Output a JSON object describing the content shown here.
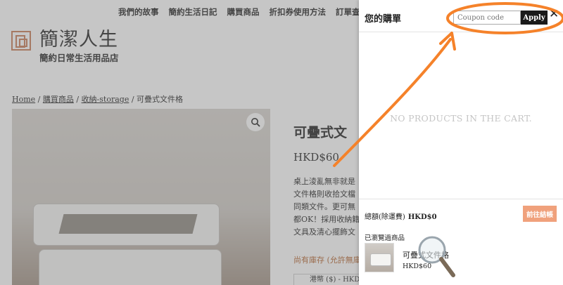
{
  "nav": {
    "items": [
      "我們的故事",
      "簡約生活日記",
      "購買商品",
      "折扣券使用方法",
      "訂單查"
    ]
  },
  "site": {
    "title": "簡潔人生",
    "tagline": "簡約日常生活用品店"
  },
  "breadcrumb": {
    "home": "Home",
    "sep": " / ",
    "shop": "購買商品",
    "category": "收納-storage",
    "current": "可疊式文件格"
  },
  "product": {
    "title": "可疊式文",
    "price": "HKD$60",
    "desc_lines": [
      "桌上淩亂無非就是",
      "文件格則收拾文檔",
      "同類文件。更可無",
      "都OK！採用收納籍",
      "文具及清心擺飾文"
    ],
    "stock": "尚有庫存 (允許無庫",
    "currency": "港幣 ($) - HKD"
  },
  "cart": {
    "title": "您的購單",
    "coupon_placeholder": "Coupon code",
    "apply_label": "Apply",
    "close_symbol": "✕",
    "empty_message": "NO PRODUCTS IN THE CART.",
    "subtotal_label": "總額(除運費)",
    "subtotal_value": "HKD$0",
    "checkout_label": "前往結帳",
    "recent_heading": "已瀏覽過商品",
    "recent_item_name": "可疊式文件格",
    "recent_item_price": "HKD$60"
  },
  "colors": {
    "annotation_orange": "#f5822a",
    "checkout_button": "#f0a17c",
    "apply_button": "#1a1a1a",
    "empty_text": "#c5c5c5"
  },
  "icons": {
    "zoom": "magnifier-icon",
    "close": "close-icon",
    "lens_overlay": "magnifying-glass-icon"
  }
}
